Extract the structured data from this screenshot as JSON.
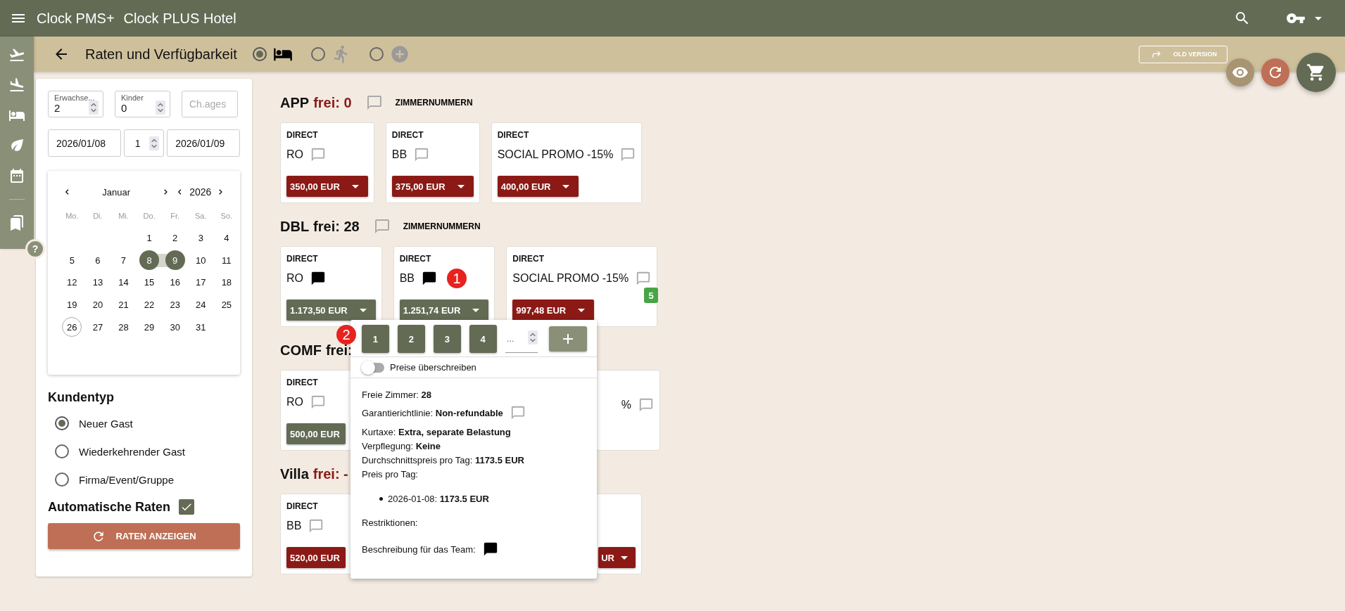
{
  "app_bar": {
    "title": "Clock PMS+",
    "hotel": "Clock PLUS Hotel"
  },
  "toolbar": {
    "title": "Raten und Verfügbarkeit",
    "modes": [
      {
        "kind": "bed",
        "selected": true
      },
      {
        "kind": "walk",
        "selected": false
      },
      {
        "kind": "add",
        "selected": false
      }
    ],
    "old_version": "OLD VERSION"
  },
  "rail": {
    "items": [
      {
        "kind": "departure"
      },
      {
        "kind": "arrival"
      },
      {
        "kind": "bed"
      },
      {
        "kind": "leaf"
      },
      {
        "kind": "calendar"
      },
      {
        "kind": "bookmarks"
      }
    ],
    "help": "?"
  },
  "search_panel": {
    "adults": {
      "label": "Erwachse...",
      "value": "2"
    },
    "children": {
      "label": "Kinder",
      "value": "0"
    },
    "child_ages": {
      "placeholder": "Ch.ages"
    },
    "arrival": "2026/01/08",
    "nights": "1",
    "departure": "2026/01/09",
    "calendar": {
      "month": "Januar",
      "year": "2026",
      "weekdays": [
        "Mo.",
        "Di.",
        "Mi.",
        "Do.",
        "Fr.",
        "Sa.",
        "So."
      ],
      "days": [
        {
          "day": "1",
          "selected": false,
          "today": false
        },
        {
          "day": "2",
          "selected": false,
          "today": false
        },
        {
          "day": "3",
          "selected": false,
          "today": false
        },
        {
          "day": "4",
          "selected": false,
          "today": false
        },
        {
          "day": "5",
          "selected": false,
          "today": false
        },
        {
          "day": "6",
          "selected": false,
          "today": false
        },
        {
          "day": "7",
          "selected": false,
          "today": false
        },
        {
          "day": "8",
          "selected": true,
          "today": false
        },
        {
          "day": "9",
          "selected": true,
          "today": false
        },
        {
          "day": "10",
          "selected": false,
          "today": false
        },
        {
          "day": "11",
          "selected": false,
          "today": false
        },
        {
          "day": "12",
          "selected": false,
          "today": false
        },
        {
          "day": "13",
          "selected": false,
          "today": false
        },
        {
          "day": "14",
          "selected": false,
          "today": false
        },
        {
          "day": "15",
          "selected": false,
          "today": false
        },
        {
          "day": "16",
          "selected": false,
          "today": false
        },
        {
          "day": "17",
          "selected": false,
          "today": false
        },
        {
          "day": "18",
          "selected": false,
          "today": false
        },
        {
          "day": "19",
          "selected": false,
          "today": false
        },
        {
          "day": "20",
          "selected": false,
          "today": false
        },
        {
          "day": "21",
          "selected": false,
          "today": false
        },
        {
          "day": "22",
          "selected": false,
          "today": false
        },
        {
          "day": "23",
          "selected": false,
          "today": false
        },
        {
          "day": "24",
          "selected": false,
          "today": false
        },
        {
          "day": "25",
          "selected": false,
          "today": false
        },
        {
          "day": "26",
          "selected": false,
          "today": true
        },
        {
          "day": "27",
          "selected": false,
          "today": false
        },
        {
          "day": "28",
          "selected": false,
          "today": false
        },
        {
          "day": "29",
          "selected": false,
          "today": false
        },
        {
          "day": "30",
          "selected": false,
          "today": false
        },
        {
          "day": "31",
          "selected": false,
          "today": false
        }
      ]
    },
    "customer_type": {
      "title": "Kundentyp",
      "options": [
        {
          "label": "Neuer Gast",
          "selected": true
        },
        {
          "label": "Wiederkehrender Gast",
          "selected": false
        },
        {
          "label": "Firma/Event/Gruppe",
          "selected": false
        }
      ]
    },
    "auto_rates": {
      "label": "Automatische Raten",
      "checked": true
    },
    "show_button": "RATEN ANZEIGEN"
  },
  "room_types": [
    {
      "name": "APP",
      "free_label": "frei: 0",
      "available": false,
      "has_comment": false,
      "room_numbers": "ZIMMERNUMMERN",
      "rates": [
        {
          "channel": "DIRECT",
          "name": "RO",
          "has_comment": false,
          "price": "350,00 EUR",
          "color": "#8b1a16"
        },
        {
          "channel": "DIRECT",
          "name": "BB",
          "has_comment": false,
          "price": "375,00 EUR",
          "color": "#8b1a16"
        },
        {
          "channel": "DIRECT",
          "name": "SOCIAL PROMO -15%",
          "has_comment": false,
          "price": "400,00 EUR",
          "color": "#8b1a16"
        }
      ]
    },
    {
      "name": "DBL",
      "free_label": "frei: 28",
      "available": true,
      "has_comment": false,
      "room_numbers": "ZIMMERNUMMERN",
      "rates": [
        {
          "channel": "DIRECT",
          "name": "RO",
          "has_comment": true,
          "price": "1.173,50 EUR",
          "color": "#636b55"
        },
        {
          "channel": "DIRECT",
          "name": "BB",
          "has_comment": true,
          "marker": "1",
          "price": "1.251,74 EUR",
          "color": "#636b55"
        },
        {
          "channel": "DIRECT",
          "name": "SOCIAL PROMO -15%",
          "has_comment": false,
          "price": "997,48 EUR",
          "color": "#8b1a16",
          "count": "5"
        }
      ],
      "rate_popup": {
        "marker": "2",
        "room_buttons": [
          "1",
          "2",
          "3",
          "4"
        ],
        "quantity_placeholder": "...",
        "override": {
          "label": "Preise überschreiben",
          "on": false
        },
        "groups": [
          [
            {
              "text": "Freie Zimmer: **28**"
            }
          ],
          [
            {
              "text": "Garantierichtlinie: **Non-refundable**",
              "has_comment": false
            }
          ],
          [
            {
              "text": "Kurtaxe: **Extra, separate Belastung**"
            },
            {
              "text": "Verpflegung: **Keine**"
            },
            {
              "text": "Durchschnittspreis pro Tag: **1173.5 EUR**"
            },
            {
              "text": "Preis pro Tag:"
            }
          ]
        ],
        "daily_prices": [
          "2026-01-08: **1173.5 EUR**"
        ],
        "restrictions_label": "Restriktionen:",
        "team_note": {
          "text": "Beschreibung für das Team:",
          "has_comment": true
        }
      }
    },
    {
      "name": "COMF",
      "free_label": "frei:",
      "available": true,
      "rates": [
        {
          "channel": "DIRECT",
          "name": "RO",
          "has_comment": false,
          "price": "500,00 EUR",
          "color": "#636b55",
          "caret": false
        },
        {
          "clipped": true,
          "name": "%",
          "has_comment": false
        }
      ]
    },
    {
      "name": "Villa",
      "free_label": "frei: -",
      "available": false,
      "rates": [
        {
          "channel": "DIRECT",
          "name": "BB",
          "has_comment": false,
          "price": "520,00 EUR",
          "color": "#8b1a16",
          "caret": false
        },
        {
          "clipped": true,
          "price": "UR",
          "color": "#8b1a16"
        }
      ]
    }
  ],
  "fabs": [
    {
      "kind": "eye"
    },
    {
      "kind": "refresh"
    },
    {
      "kind": "cart"
    }
  ]
}
